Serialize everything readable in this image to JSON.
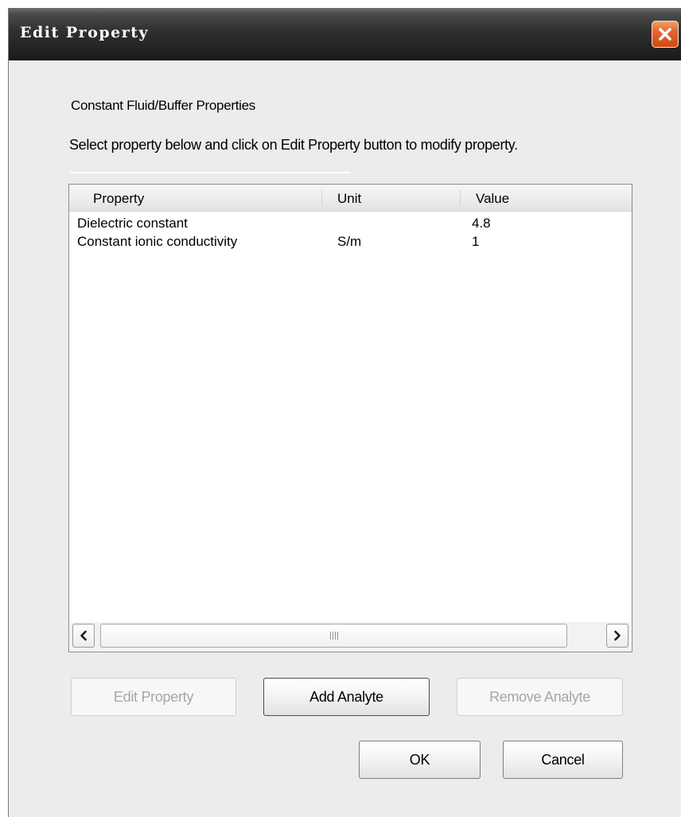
{
  "window": {
    "title": "Edit Property"
  },
  "dialog": {
    "heading": "Constant Fluid/Buffer Properties",
    "instructions": "Select property below and click on Edit Property button to modify property."
  },
  "table": {
    "columns": [
      "Property",
      "Unit",
      "Value"
    ],
    "rows": [
      {
        "property": "Dielectric constant",
        "unit": "",
        "value": "4.8"
      },
      {
        "property": "Constant ionic conductivity",
        "unit": "S/m",
        "value": "1"
      }
    ]
  },
  "buttons": {
    "edit_property": "Edit Property",
    "add_analyte": "Add Analyte",
    "remove_analyte": "Remove Analyte",
    "ok": "OK",
    "cancel": "Cancel"
  },
  "icons": {
    "close": "close-icon",
    "scroll_left": "chevron-left-icon",
    "scroll_right": "chevron-right-icon"
  },
  "colors": {
    "close_button": "#e3642c",
    "titlebar": "#2a2a2a",
    "dialog_background": "#ececec"
  }
}
